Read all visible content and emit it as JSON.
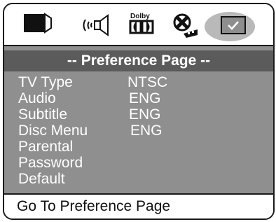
{
  "tabs": [
    {
      "name": "general-setup",
      "icon": "tv-monitor-icon"
    },
    {
      "name": "audio-setup",
      "icon": "speaker-icon"
    },
    {
      "name": "dolby-digital-setup",
      "icon": "dolby-logo-icon",
      "logo_text": "Dolby"
    },
    {
      "name": "video-setup",
      "icon": "film-reel-icon"
    },
    {
      "name": "preference",
      "icon": "checkmark-icon",
      "selected": true
    }
  ],
  "page": {
    "title": "-- Preference Page --"
  },
  "settings": [
    {
      "label": "TV Type",
      "value": "NTSC"
    },
    {
      "label": "Audio",
      "value": "ENG"
    },
    {
      "label": "Subtitle",
      "value": "ENG"
    },
    {
      "label": "Disc Menu",
      "value": "ENG"
    },
    {
      "label": "Parental",
      "value": ""
    },
    {
      "label": "Password",
      "value": ""
    },
    {
      "label": "Default",
      "value": ""
    }
  ],
  "status": {
    "text": "Go To Preference Page"
  },
  "colors": {
    "panel": "#8f8f8f",
    "title_bar": "#5b5b5b",
    "selected_tab": "#b9b9b9",
    "text": "#ffffff"
  }
}
